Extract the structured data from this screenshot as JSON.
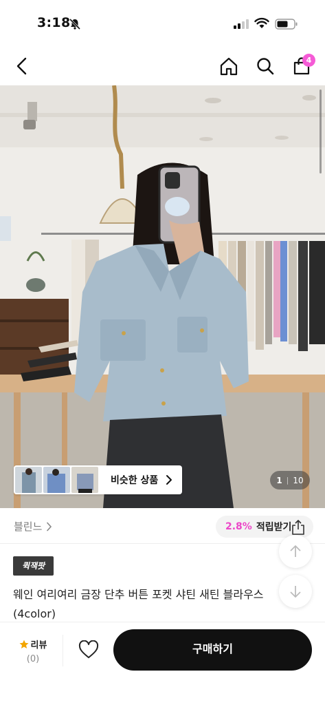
{
  "status_bar": {
    "time": "3:18"
  },
  "nav": {
    "cart_count": "4"
  },
  "gallery": {
    "similar_label": "비슷한 상품",
    "pager_current": "1",
    "pager_total": "10"
  },
  "brand": {
    "name": "블린느"
  },
  "points": {
    "percent": "2.8%",
    "label": "적립받기"
  },
  "product": {
    "badge": "퀵잭팟",
    "title": "웨인 여리여리 금장 단추 버튼 포켓 샤틴 새틴 블라우스 (4color)"
  },
  "bottom_bar": {
    "review_label": "리뷰",
    "review_count": "(0)",
    "buy_label": "구매하기"
  },
  "colors": {
    "accent_pink": "#ec47c8",
    "badge_pink": "#f55bd6",
    "buy_button": "#111111"
  },
  "icons": [
    "bell-slash-icon",
    "signal-icon",
    "wifi-icon",
    "battery-icon",
    "back-icon",
    "home-icon",
    "search-icon",
    "shopping-bag-icon",
    "chevron-right-icon",
    "share-icon",
    "arrow-up-icon",
    "arrow-down-icon",
    "star-icon",
    "heart-icon"
  ]
}
